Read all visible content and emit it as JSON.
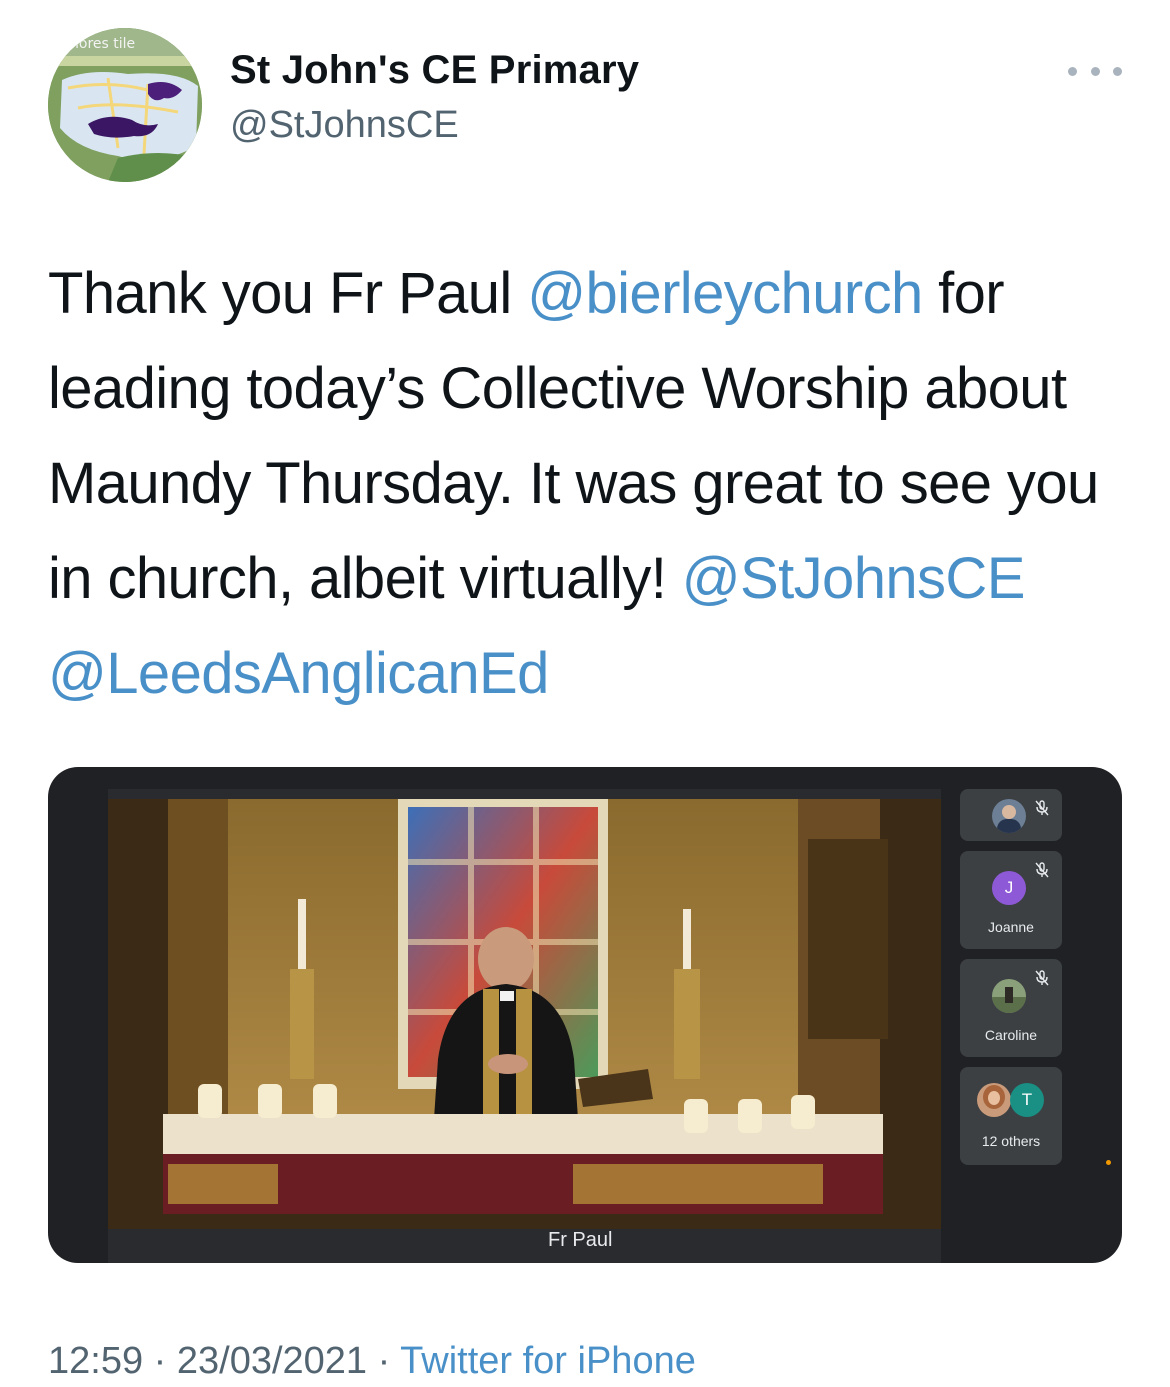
{
  "profile": {
    "display_name": "St John's CE Primary",
    "handle": "@StJohnsCE",
    "avatar_text": "nores tile",
    "more_icon": "more-options-icon"
  },
  "tweet": {
    "segments": [
      {
        "text": "Thank you Fr Paul ",
        "mention": false
      },
      {
        "text": "@bierleychurch",
        "mention": true
      },
      {
        "text": " for leading today’s Collective Worship about Maundy Thursday. It was great to see you in church, albeit virtually! ",
        "mention": false
      },
      {
        "text": "@StJohnsCE",
        "mention": true
      },
      {
        "text": " ",
        "mention": false
      },
      {
        "text": "@LeedsAnglicanEd",
        "mention": true
      }
    ]
  },
  "media": {
    "speaker_name": "Fr Paul",
    "participants": [
      {
        "name": "",
        "avatar": "photo",
        "muted": true
      },
      {
        "name": "Joanne",
        "initial": "J",
        "avatar_color": "#8e59d6",
        "muted": true
      },
      {
        "name": "Caroline",
        "avatar": "photo",
        "muted": true
      },
      {
        "name": "12 others",
        "initial": "T",
        "avatar_color": "#1a8f84",
        "muted": false
      }
    ]
  },
  "footer": {
    "time": "12:59",
    "separator": " · ",
    "date": "23/03/2021",
    "source": "Twitter for iPhone"
  },
  "colors": {
    "link": "#4a90c8",
    "secondary_text": "#536471",
    "call_background": "#202124"
  }
}
